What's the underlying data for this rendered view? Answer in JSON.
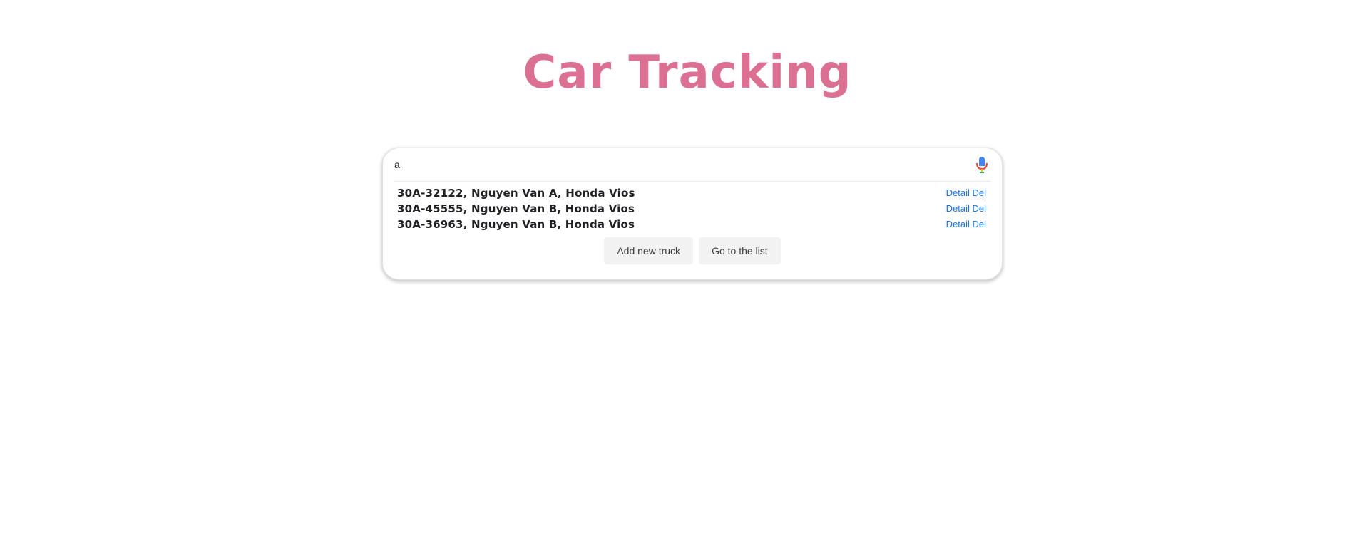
{
  "app": {
    "title": "Car Tracking",
    "title_color": "#db7093"
  },
  "search": {
    "value": "a",
    "icon": "microphone-icon"
  },
  "results": [
    {
      "text": "30A-32122, Nguyen Van A, Honda Vios",
      "detail_label": "Detail",
      "del_label": "Del"
    },
    {
      "text": "30A-45555, Nguyen Van B, Honda Vios",
      "detail_label": "Detail",
      "del_label": "Del"
    },
    {
      "text": "30A-36963, Nguyen Van B, Honda Vios",
      "detail_label": "Detail",
      "del_label": "Del"
    }
  ],
  "buttons": {
    "add_label": "Add new truck",
    "list_label": "Go to the list"
  },
  "colors": {
    "link": "#1a73e8",
    "button_bg": "#f2f2f2"
  }
}
